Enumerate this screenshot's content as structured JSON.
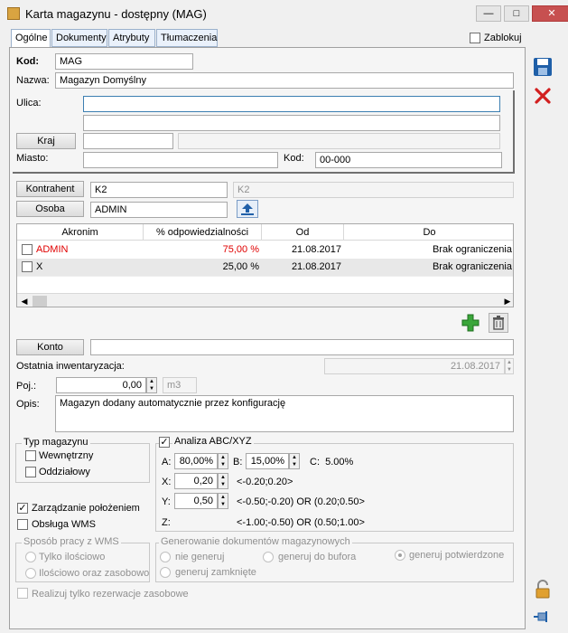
{
  "window": {
    "title": "Karta magazynu - dostępny (MAG)"
  },
  "tabs": [
    "Ogólne",
    "Dokumenty",
    "Atrybuty",
    "Tłumaczenia"
  ],
  "blocked_label": "Zablokuj",
  "form": {
    "kod_label": "Kod:",
    "kod_value": "MAG",
    "nazwa_label": "Nazwa:",
    "nazwa_value": "Magazyn Domyślny",
    "ulica_label": "Ulica:",
    "kraj_button": "Kraj",
    "miasto_label": "Miasto:",
    "kod_poczt_label": "Kod:",
    "kod_poczt_value": "00-000",
    "kontrahent_button": "Kontrahent",
    "kontrahent_value": "K2",
    "kontrahent_name": "K2",
    "osoba_button": "Osoba",
    "osoba_value": "ADMIN"
  },
  "grid": {
    "headers": [
      "Akronim",
      "% odpowiedzialności",
      "Od",
      "Do"
    ],
    "rows": [
      {
        "akronim": "ADMIN",
        "percent": "75,00 %",
        "od": "21.08.2017",
        "do": "Brak ograniczenia",
        "highlight": true
      },
      {
        "akronim": "X",
        "percent": "25,00 %",
        "od": "21.08.2017",
        "do": "Brak ograniczenia",
        "highlight": false
      }
    ]
  },
  "konto_button": "Konto",
  "inwentaryzacja": {
    "label": "Ostatnia inwentaryzacja:",
    "value": "21.08.2017"
  },
  "poj": {
    "label": "Poj.:",
    "value": "0,00",
    "unit": "m3"
  },
  "opis": {
    "label": "Opis:",
    "value": "Magazyn dodany automatycznie przez konfigurację"
  },
  "typ": {
    "title": "Typ magazynu",
    "opt1": "Wewnętrzny",
    "opt2": "Oddziałowy"
  },
  "abc": {
    "label": "Analiza ABC/XYZ",
    "a_label": "A:",
    "a_value": "80,00%",
    "b_label": "B:",
    "b_value": "15,00%",
    "c_text": "C:  5.00%",
    "x_label": "X:",
    "x_value": "0,20",
    "x_range": "<-0.20;0.20>",
    "y_label": "Y:",
    "y_value": "0,50",
    "y_range": "<-0.50;-0.20) OR (0.20;0.50>",
    "z_label": "Z:",
    "z_range": "<-1.00;-0.50) OR (0.50;1.00>"
  },
  "zarzadzanie": "Zarządzanie położeniem",
  "obsluga_wms": "Obsługa WMS",
  "wms": {
    "title": "Sposób pracy z WMS",
    "opt1": "Tylko ilościowo",
    "opt2": "Ilościowo oraz zasobowo"
  },
  "gen": {
    "title": "Generowanie dokumentów magazynowych",
    "opt1": "nie generuj",
    "opt2": "generuj do bufora",
    "opt3": "generuj potwierdzone",
    "opt4": "generuj zamknięte"
  },
  "realizuj": "Realizuj tylko rezerwacje zasobowe",
  "colors": {
    "accent": "#3c7fb1",
    "red_text": "#e00000",
    "close": "#c75050"
  }
}
